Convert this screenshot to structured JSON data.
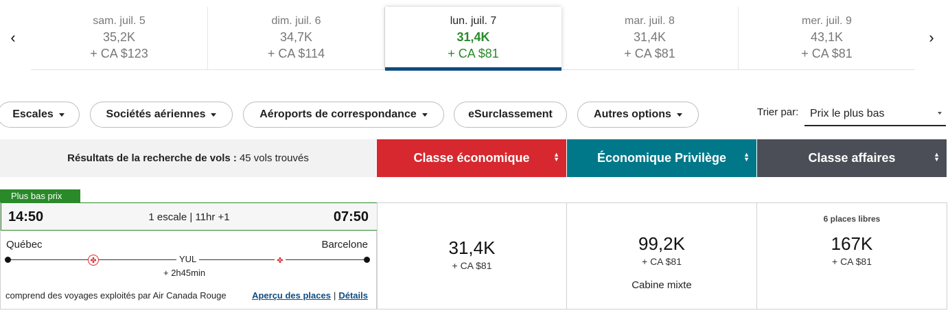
{
  "date_strip": {
    "prev_arrow": "‹",
    "next_arrow": "›",
    "days": [
      {
        "label": "sam. juil. 5",
        "points": "35,2K",
        "cash": "+ CA $123",
        "selected": false
      },
      {
        "label": "dim. juil. 6",
        "points": "34,7K",
        "cash": "+ CA $114",
        "selected": false
      },
      {
        "label": "lun. juil. 7",
        "points": "31,4K",
        "cash": "+ CA $81",
        "selected": true
      },
      {
        "label": "mar. juil. 8",
        "points": "31,4K",
        "cash": "+ CA $81",
        "selected": false
      },
      {
        "label": "mer. juil. 9",
        "points": "43,1K",
        "cash": "+ CA $81",
        "selected": false
      }
    ]
  },
  "filters": {
    "stops": "Escales",
    "airlines": "Sociétés aériennes",
    "connecting_airports": "Aéroports de correspondance",
    "upgrade": "eSurclassement",
    "more_options": "Autres options"
  },
  "sort": {
    "label": "Trier par:",
    "value": "Prix le plus bas"
  },
  "results_header": {
    "label": "Résultats de la recherche de vols :",
    "count": "45 vols trouvés"
  },
  "cabins": {
    "economy": "Classe économique",
    "premium": "Économique Privilège",
    "business": "Classe affaires",
    "sort_icon": "up-down-arrows-icon"
  },
  "colors": {
    "economy": "#d7282f",
    "premium": "#00788a",
    "business": "#4b4e56",
    "selected_price": "#2a8a2a",
    "selected_underline": "#0f4c81"
  },
  "flight": {
    "badge": "Plus bas prix",
    "departure_time": "14:50",
    "arrival_time": "07:50",
    "summary": "1 escale | 11hr +1",
    "origin": "Québec",
    "destination": "Barcelone",
    "stop_code": "YUL",
    "layover": "+ 2h45min",
    "operated_by": "comprend des voyages exploités par Air Canada Rouge",
    "seat_preview_link": "Aperçu des places",
    "separator": "|",
    "details_link": "Détails",
    "airline_icon": "maple-leaf-icon",
    "fares": {
      "economy": {
        "points": "31,4K",
        "cash": "+ CA $81"
      },
      "premium": {
        "points": "99,2K",
        "cash": "+ CA $81",
        "note": "Cabine mixte"
      },
      "business": {
        "seats": "6 places libres",
        "points": "167K",
        "cash": "+ CA $81"
      }
    }
  }
}
